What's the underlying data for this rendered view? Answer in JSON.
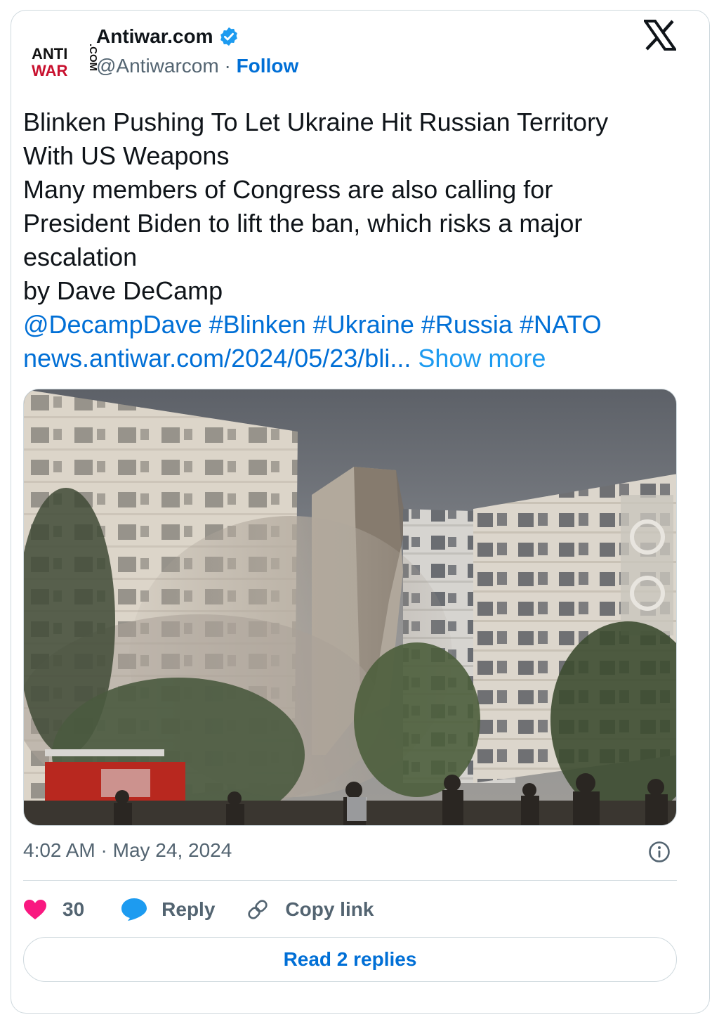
{
  "author": {
    "name": "Antiwar.com",
    "handle": "@Antiwarcom",
    "separator": "·",
    "follow_label": "Follow",
    "verified": true,
    "logo_text_top": "ANTI",
    "logo_text_bottom": "WAR",
    "logo_text_side": ".COM"
  },
  "tweet": {
    "lines": [
      "Blinken Pushing To Let Ukraine Hit Russian Territory",
      "With US Weapons",
      "Many members of Congress are also calling for",
      "President Biden to lift the ban, which risks a major",
      "escalation",
      "by Dave DeCamp"
    ],
    "mention": "@DecampDave",
    "hashtags": [
      "#Blinken",
      "#Ukraine",
      "#Russia",
      "#NATO"
    ],
    "url": "news.antiwar.com/2024/05/23/bli...",
    "show_more": "Show more"
  },
  "media": {
    "description_icon": "photo-collapsed-building"
  },
  "meta": {
    "time": "4:02 AM",
    "separator": "·",
    "date": "May 24, 2024"
  },
  "actions": {
    "like_count": "30",
    "reply_label": "Reply",
    "copy_link_label": "Copy link"
  },
  "read_replies_label": "Read 2 replies",
  "colors": {
    "link": "#006fd6",
    "show_more": "#1d9bf0",
    "like": "#f91880",
    "reply_icon": "#1d9bf0",
    "muted": "#536471",
    "border": "#cfd9de",
    "logo_black": "#111111",
    "logo_red": "#c8102e"
  }
}
